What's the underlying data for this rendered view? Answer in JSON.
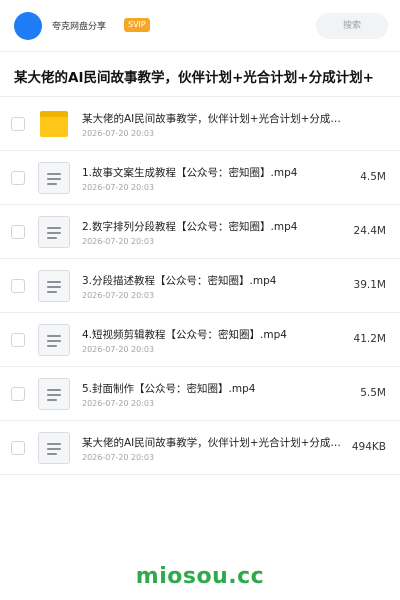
{
  "header": {
    "user_name": "夸克网盘分享",
    "badge": "SVIP",
    "search_placeholder": "搜索"
  },
  "folder": {
    "title": "某大佬的AI民间故事教学，伙伴计划+光合计划+分成计划+"
  },
  "files": [
    {
      "icon": "folder-icon",
      "name": "某大佬的AI民间故事教学，伙伴计划+光合计划+分成计划+...",
      "date": "2026-07-20 20:03",
      "size": ""
    },
    {
      "icon": "document-icon",
      "name": "1.故事文案生成教程【公众号：密知圈】.mp4",
      "date": "2026-07-20 20:03",
      "size": "4.5M"
    },
    {
      "icon": "document-icon",
      "name": "2.数字排列分段教程【公众号：密知圈】.mp4",
      "date": "2026-07-20 20:03",
      "size": "24.4M"
    },
    {
      "icon": "document-icon",
      "name": "3.分段描述教程【公众号：密知圈】.mp4",
      "date": "2026-07-20 20:03",
      "size": "39.1M"
    },
    {
      "icon": "document-icon",
      "name": "4.短视频剪辑教程【公众号：密知圈】.mp4",
      "date": "2026-07-20 20:03",
      "size": "41.2M"
    },
    {
      "icon": "document-icon",
      "name": "5.封面制作【公众号：密知圈】.mp4",
      "date": "2026-07-20 20:03",
      "size": "5.5M"
    },
    {
      "icon": "document-icon",
      "name": "某大佬的AI民间故事教学，伙伴计划+光合计划+分成计划+...",
      "date": "2026-07-20 20:03",
      "size": "494KB"
    }
  ],
  "watermark": "miosou.cc",
  "colors": {
    "avatar": "#1f7bf6",
    "badge": "#f5a623",
    "folder": "#ffc61a",
    "watermark": "#2eaa4c"
  }
}
